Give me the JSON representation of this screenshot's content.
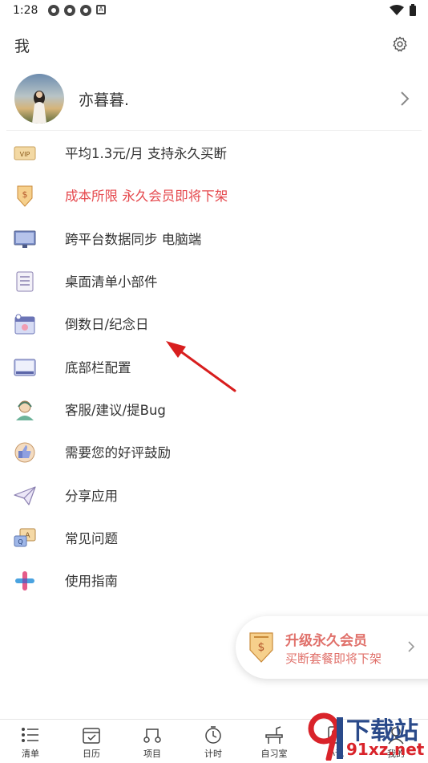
{
  "status_bar": {
    "time": "1:28",
    "left_icon_badge": "A"
  },
  "header": {
    "title": "我",
    "settings_icon": "gear-icon"
  },
  "profile": {
    "name": "亦暮暮.",
    "avatar_icon": "avatar"
  },
  "menu": [
    {
      "label": "平均1.3元/月 支持永久买断",
      "icon": "vip-icon",
      "highlight": false
    },
    {
      "label": "成本所限 永久会员即将下架",
      "icon": "price-tag-icon",
      "highlight": true
    },
    {
      "label": "跨平台数据同步 电脑端",
      "icon": "monitor-icon",
      "highlight": false
    },
    {
      "label": "桌面清单小部件",
      "icon": "checklist-icon",
      "highlight": false
    },
    {
      "label": "倒数日/纪念日",
      "icon": "calendar-clock-icon",
      "highlight": false
    },
    {
      "label": "底部栏配置",
      "icon": "bottom-bar-icon",
      "highlight": false
    },
    {
      "label": "客服/建议/提Bug",
      "icon": "customer-service-icon",
      "highlight": false
    },
    {
      "label": "需要您的好评鼓励",
      "icon": "thumbs-up-icon",
      "highlight": false
    },
    {
      "label": "分享应用",
      "icon": "paper-plane-icon",
      "highlight": false
    },
    {
      "label": "常见问题",
      "icon": "faq-icon",
      "highlight": false
    },
    {
      "label": "使用指南",
      "icon": "guide-icon",
      "highlight": false
    }
  ],
  "upgrade_banner": {
    "title": "升级永久会员",
    "subtitle": "买断套餐即将下架"
  },
  "bottom_nav": [
    {
      "label": "清单",
      "icon": "list-icon"
    },
    {
      "label": "日历",
      "icon": "calendar-icon"
    },
    {
      "label": "项目",
      "icon": "project-icon"
    },
    {
      "label": "计时",
      "icon": "timer-icon"
    },
    {
      "label": "自习室",
      "icon": "study-room-icon"
    },
    {
      "label": "小记",
      "icon": "notes-icon"
    },
    {
      "label": "我的",
      "icon": "profile-icon"
    }
  ],
  "watermark": {
    "line1": "下载站",
    "line2": "91xz.net"
  },
  "colors": {
    "highlight": "#e5484d",
    "upgrade_text": "#e0706a",
    "annotation_arrow": "#d81e1e"
  }
}
